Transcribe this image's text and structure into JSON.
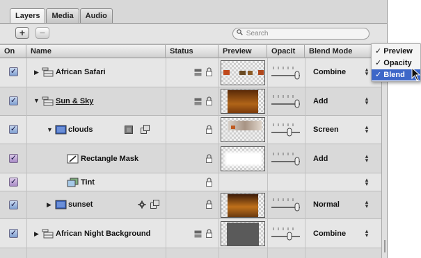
{
  "tabs": [
    "Layers",
    "Media",
    "Audio"
  ],
  "toolbar": {
    "add_label": "+",
    "remove_label": "−",
    "search_placeholder": "Search"
  },
  "columns": {
    "on": "On",
    "name": "Name",
    "status": "Status",
    "preview": "Preview",
    "opacity": "Opacit",
    "blend": "Blend Mode"
  },
  "rows": [
    {
      "name": "African Safari",
      "blend": "Combine"
    },
    {
      "name": "Sun & Sky",
      "blend": "Add"
    },
    {
      "name": "clouds",
      "blend": "Screen"
    },
    {
      "name": "Rectangle Mask",
      "blend": "Add"
    },
    {
      "name": "Tint",
      "blend": ""
    },
    {
      "name": "sunset",
      "blend": "Normal"
    },
    {
      "name": "African Night Background",
      "blend": "Combine"
    }
  ],
  "menu": {
    "items": [
      "Preview",
      "Opacity",
      "Blend"
    ],
    "check": "✓"
  },
  "colors": {
    "accent": "#3d67c8",
    "check": "#7f9fd0"
  }
}
